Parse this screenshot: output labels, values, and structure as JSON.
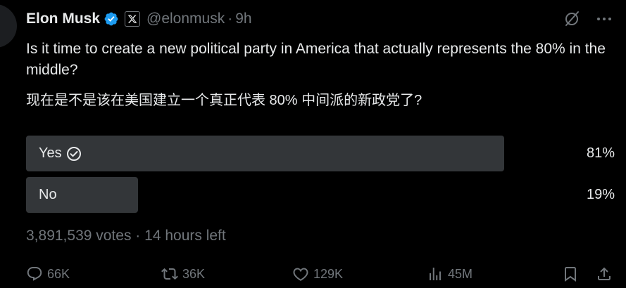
{
  "colors": {
    "background": "#000000",
    "text_primary": "#e7e9ea",
    "text_secondary": "#71767b",
    "verified_blue": "#1d9bf0",
    "poll_bar": "#333639"
  },
  "tweet": {
    "author": {
      "name": "Elon Musk",
      "handle": "@elonmusk",
      "separator": "·",
      "time": "9h",
      "verified_icon": "verified-badge-icon",
      "affiliate_icon": "x-logo-icon"
    },
    "text": "Is it time to create a new political party in America that actually represents the 80% in the middle?",
    "text_translation": "现在是不是该在美国建立一个真正代表 80% 中间派的新政党了?",
    "poll": {
      "options": [
        {
          "label": "Yes",
          "percent_text": "81%",
          "percent": 81,
          "selected": true,
          "selected_icon": "check-circle-icon"
        },
        {
          "label": "No",
          "percent_text": "19%",
          "percent": 19,
          "selected": false
        }
      ],
      "votes": "3,891,539 votes",
      "separator": "·",
      "time_left": "14 hours left"
    },
    "actions": {
      "reply": {
        "icon": "reply-icon",
        "count": "66K"
      },
      "repost": {
        "icon": "repost-icon",
        "count": "36K"
      },
      "like": {
        "icon": "heart-icon",
        "count": "129K"
      },
      "views": {
        "icon": "views-icon",
        "count": "45M"
      },
      "bookmark": {
        "icon": "bookmark-icon"
      },
      "share": {
        "icon": "share-icon"
      }
    },
    "top_actions": {
      "grok": {
        "icon": "grok-icon"
      },
      "more": {
        "icon": "more-icon"
      }
    }
  }
}
